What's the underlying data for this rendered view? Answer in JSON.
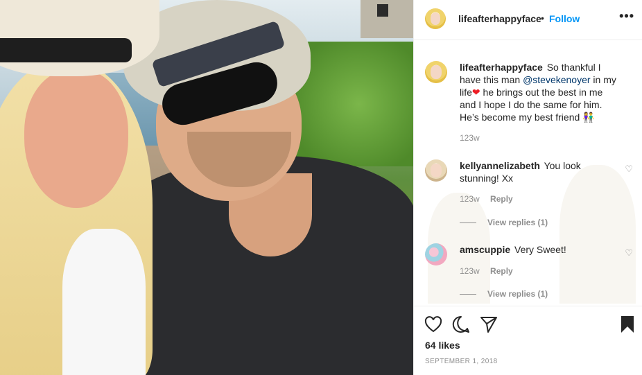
{
  "post": {
    "author": "lifeafterhappyface",
    "follow_label": "Follow",
    "more_icon": "more-horizontal-icon",
    "caption": {
      "username": "lifeafterhappyface",
      "text_before": "So thankful I have this man ",
      "mention": "@stevekenoyer",
      "text_after": " in my life",
      "heart": "❤",
      "line2": "he brings out the best in me and I hope I do the same for him.",
      "line3": "He’s become my best friend",
      "emoji": "👫",
      "age": "123w"
    },
    "comments": [
      {
        "username": "kellyannelizabeth",
        "text": "You look stunning! Xx",
        "age": "123w",
        "reply_label": "Reply",
        "view_replies": "View replies (1)"
      },
      {
        "username": "amscuppie",
        "text": "Very Sweet!",
        "age": "123w",
        "reply_label": "Reply",
        "view_replies": "View replies (1)"
      }
    ],
    "likes": "64 likes",
    "date": "SEPTEMBER 1, 2018"
  },
  "icons": {
    "heart": "heart-outline-icon",
    "comment": "comment-bubble-icon",
    "share": "share-paper-plane-icon",
    "save": "bookmark-filled-icon"
  },
  "colors": {
    "follow_blue": "#0095f6",
    "mention_blue": "#00376b",
    "secondary_gray": "#8e8e8e"
  }
}
